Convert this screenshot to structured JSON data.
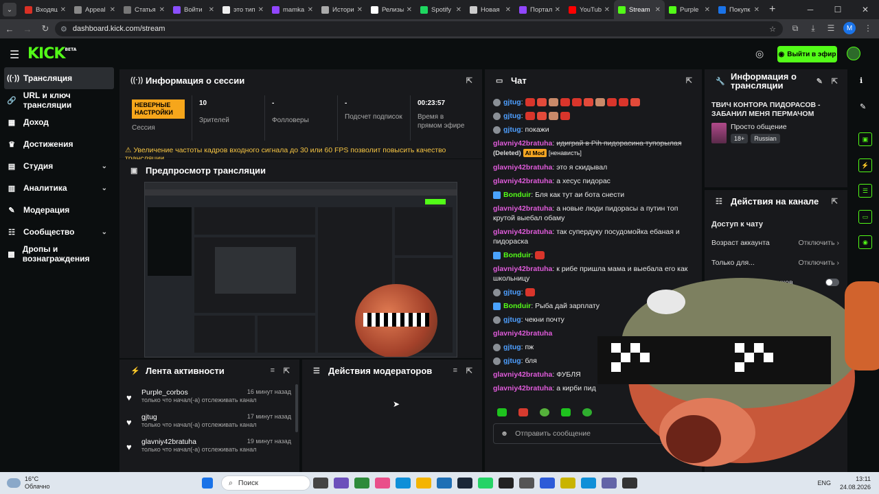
{
  "browser": {
    "tabs": [
      "Входящ",
      "Appeal",
      "Статья",
      "Войти",
      "это тип",
      "mamka",
      "Истори",
      "Релизы",
      "Spotify",
      "Новая",
      "Портал",
      "YouTub",
      "Stream",
      "Purple",
      "Покупк"
    ],
    "tab_colors": [
      "#d93025",
      "#888888",
      "#777777",
      "#8a4fff",
      "#eeeeee",
      "#9146ff",
      "#aaaaaa",
      "#ffffff",
      "#1ed760",
      "#cccccc",
      "#9146ff",
      "#ff0000",
      "#53fc18",
      "#53fc18",
      "#1a73e8"
    ],
    "active_tab": "Stream",
    "url": "dashboard.kick.com/stream",
    "profile": "M"
  },
  "header": {
    "logo": "KICK",
    "logo_sup": "BETA",
    "go_live": "Выйти в эфир"
  },
  "sidebar": {
    "items": [
      {
        "label": "Трансляция",
        "icon": "broadcast-icon"
      },
      {
        "label": "URL и ключ трансляции",
        "icon": "link-icon"
      },
      {
        "label": "Доход",
        "icon": "money-icon"
      },
      {
        "label": "Достижения",
        "icon": "trophy-icon"
      },
      {
        "label": "Студия",
        "icon": "studio-icon"
      },
      {
        "label": "Аналитика",
        "icon": "chart-icon"
      },
      {
        "label": "Модерация",
        "icon": "mod-icon"
      },
      {
        "label": "Сообщество",
        "icon": "community-icon"
      },
      {
        "label": "Дропы и вознаграждения",
        "icon": "gift-icon"
      }
    ]
  },
  "session": {
    "title": "Информация о сессии",
    "badge": "НЕВЕРНЫЕ НАСТРОЙКИ",
    "badge_label": "Сессия",
    "viewers_value": "10",
    "viewers_label": "Зрителей",
    "followers_value": "-",
    "followers_label": "Фолловеры",
    "subs_value": "-",
    "subs_label": "Подсчет подписок",
    "time_value": "00:23:57",
    "time_label": "Время в прямом эфире",
    "warning": "Увеличение частоты кадров входного сигнала до 30 или 60 FPS позволит повысить качество трансляции."
  },
  "preview": {
    "title": "Предпросмотр трансляции"
  },
  "activity": {
    "title": "Лента активности",
    "items": [
      {
        "name": "Purple_corbos",
        "sub": "только что начал(-а) отслеживать канал",
        "time": "16 минут назад"
      },
      {
        "name": "gjtug",
        "sub": "только что начал(-а) отслеживать канал",
        "time": "17 минут назад"
      },
      {
        "name": "glavniy42bratuha",
        "sub": "только что начал(-а) отслеживать канал",
        "time": "19 минут назад"
      }
    ]
  },
  "mod_actions": {
    "title": "Действия модераторов"
  },
  "chat": {
    "title": "Чат",
    "messages": [
      {
        "user": "gjtug",
        "color": "#4e9fff",
        "text": ":",
        "emotes": 10
      },
      {
        "user": "gjtug",
        "color": "#4e9fff",
        "text": ":",
        "emotes": 4
      },
      {
        "user": "gjtug",
        "color": "#4e9fff",
        "text": ": покажи"
      },
      {
        "user": "glavniy42bratuha",
        "color": "#e05bdb",
        "text": "идиграй в Pih пидорасина тупорылая",
        "deleted": "(Deleted)",
        "badge": "AI Mod",
        "tag": "[ненависть]"
      },
      {
        "user": "glavniy42bratuha",
        "color": "#e05bdb",
        "text": ": это я скидывал"
      },
      {
        "user": "glavniy42bratuha",
        "color": "#e05bdb",
        "text": ": а хесус пидорас"
      },
      {
        "user": "Bonduir",
        "color": "#53fc18",
        "text": ": Бля как тут аи бота снести"
      },
      {
        "user": "glavniy42bratuha",
        "color": "#e05bdb",
        "text": ": а новые люди пидорасы а путин топ крутой выебал обаму"
      },
      {
        "user": "glavniy42bratuha",
        "color": "#e05bdb",
        "text": ": так супердуку посудомойка ебаная и пидораска"
      },
      {
        "user": "Bonduir",
        "color": "#53fc18",
        "text": ":",
        "emotes": 1
      },
      {
        "user": "glavniy42bratuha",
        "color": "#e05bdb",
        "text": ": к рибе пришла мама и выебала его как школьницу"
      },
      {
        "user": "gjtug",
        "color": "#4e9fff",
        "text": ":",
        "emotes": 1
      },
      {
        "user": "Bonduir",
        "color": "#53fc18",
        "text": ": Рыба дай зарплату"
      },
      {
        "user": "gjtug",
        "color": "#4e9fff",
        "text": ": чекни почту"
      },
      {
        "user": "glavniy42bratuha",
        "color": "#e05bdb",
        "text": ""
      },
      {
        "user": "gjtug",
        "color": "#4e9fff",
        "text": ": пж"
      },
      {
        "user": "gjtug",
        "color": "#4e9fff",
        "text": ": бля"
      },
      {
        "user": "glavniy42bratuha",
        "color": "#e05bdb",
        "text": ": ФУБЛЯ"
      },
      {
        "user": "glavniy42bratuha",
        "color": "#e05bdb",
        "text": ": а кирби пид"
      }
    ],
    "input_placeholder": "Отправить сообщение"
  },
  "stream_info": {
    "title": "Информация о трансляции",
    "stream_title": "ТВИЧ КОНТОРА ПИДОРАСОВ - ЗАБАНИЛ МЕНЯ ПЕРМАЧОМ",
    "category": "Просто общение",
    "tags": [
      "18+",
      "Russian"
    ]
  },
  "channel_actions": {
    "title": "Действия на канале",
    "section": "Доступ к чату",
    "rows": [
      {
        "label": "Возраст аккаунта",
        "value": "Отключить"
      },
      {
        "label": "Только для...",
        "value": "Отключить"
      },
      {
        "label": "Только для подписчиков",
        "value": ""
      }
    ]
  },
  "taskbar": {
    "weather_temp": "16°C",
    "weather_desc": "Облачно",
    "search_placeholder": "Поиск",
    "lang": "ENG",
    "time": "13:11",
    "date": "24.08.2026"
  }
}
